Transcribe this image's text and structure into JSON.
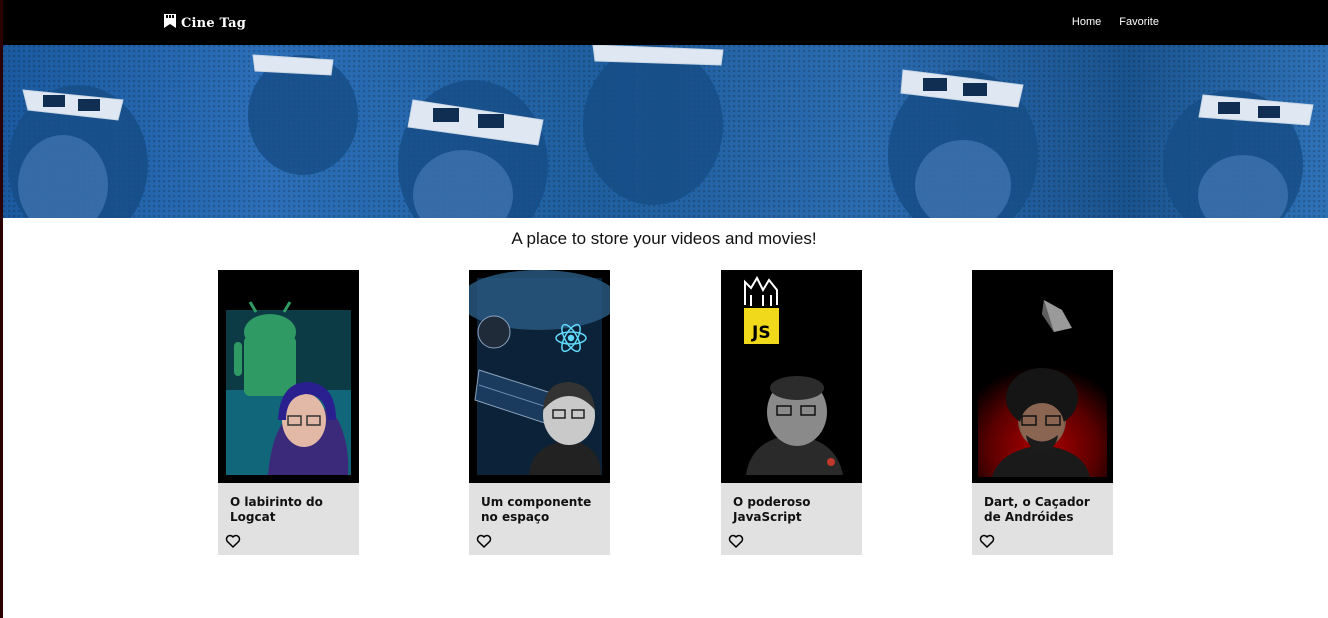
{
  "navbar": {
    "logo_text": "Cine Tag",
    "links": [
      "Home",
      "Favorite"
    ]
  },
  "tagline": "A place to store your videos and movies!",
  "videos": [
    {
      "title": "O labirinto do Logcat",
      "favorite": false
    },
    {
      "title": "Um componente no espaço",
      "favorite": false
    },
    {
      "title": "O poderoso JavaScript",
      "favorite": false
    },
    {
      "title": "Dart, o Caçador de Andróides",
      "favorite": false
    }
  ],
  "thumbnail_labels": {
    "js_logo": "JS"
  },
  "colors": {
    "navbar_bg": "#000000",
    "banner_blue": "#2c6fb8",
    "card_bg": "#e1e1e1"
  }
}
